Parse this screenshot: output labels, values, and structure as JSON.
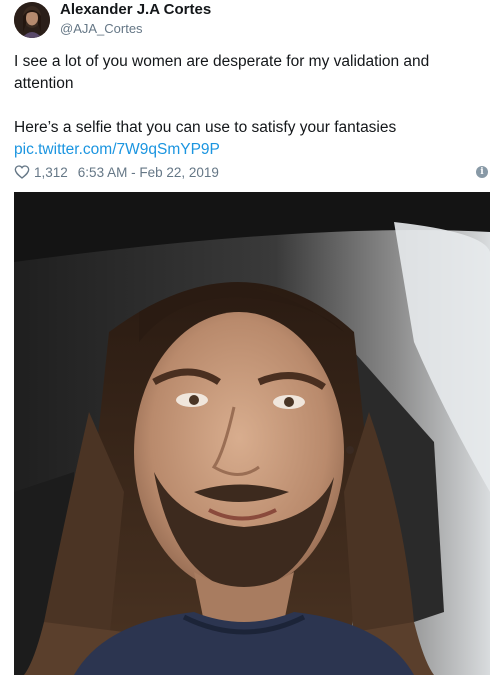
{
  "tweet": {
    "display_name": "Alexander J.A Cortes",
    "handle": "@AJA_Cortes",
    "text_line1": "I see a lot of you women are desperate for my validation and attention",
    "text_line2": "Here’s a selfie that you can use to satisfy your fantasies",
    "link": "pic.twitter.com/7W9qSmYP9P",
    "like_count": "1,312",
    "timestamp": "6:53 AM - Feb 22, 2019",
    "info_glyph": "i"
  },
  "icons": {
    "avatar": "avatar",
    "like": "heart-icon",
    "info": "info-icon"
  },
  "colors": {
    "link": "#1b95e0",
    "muted": "#657786",
    "text": "#14171a"
  }
}
